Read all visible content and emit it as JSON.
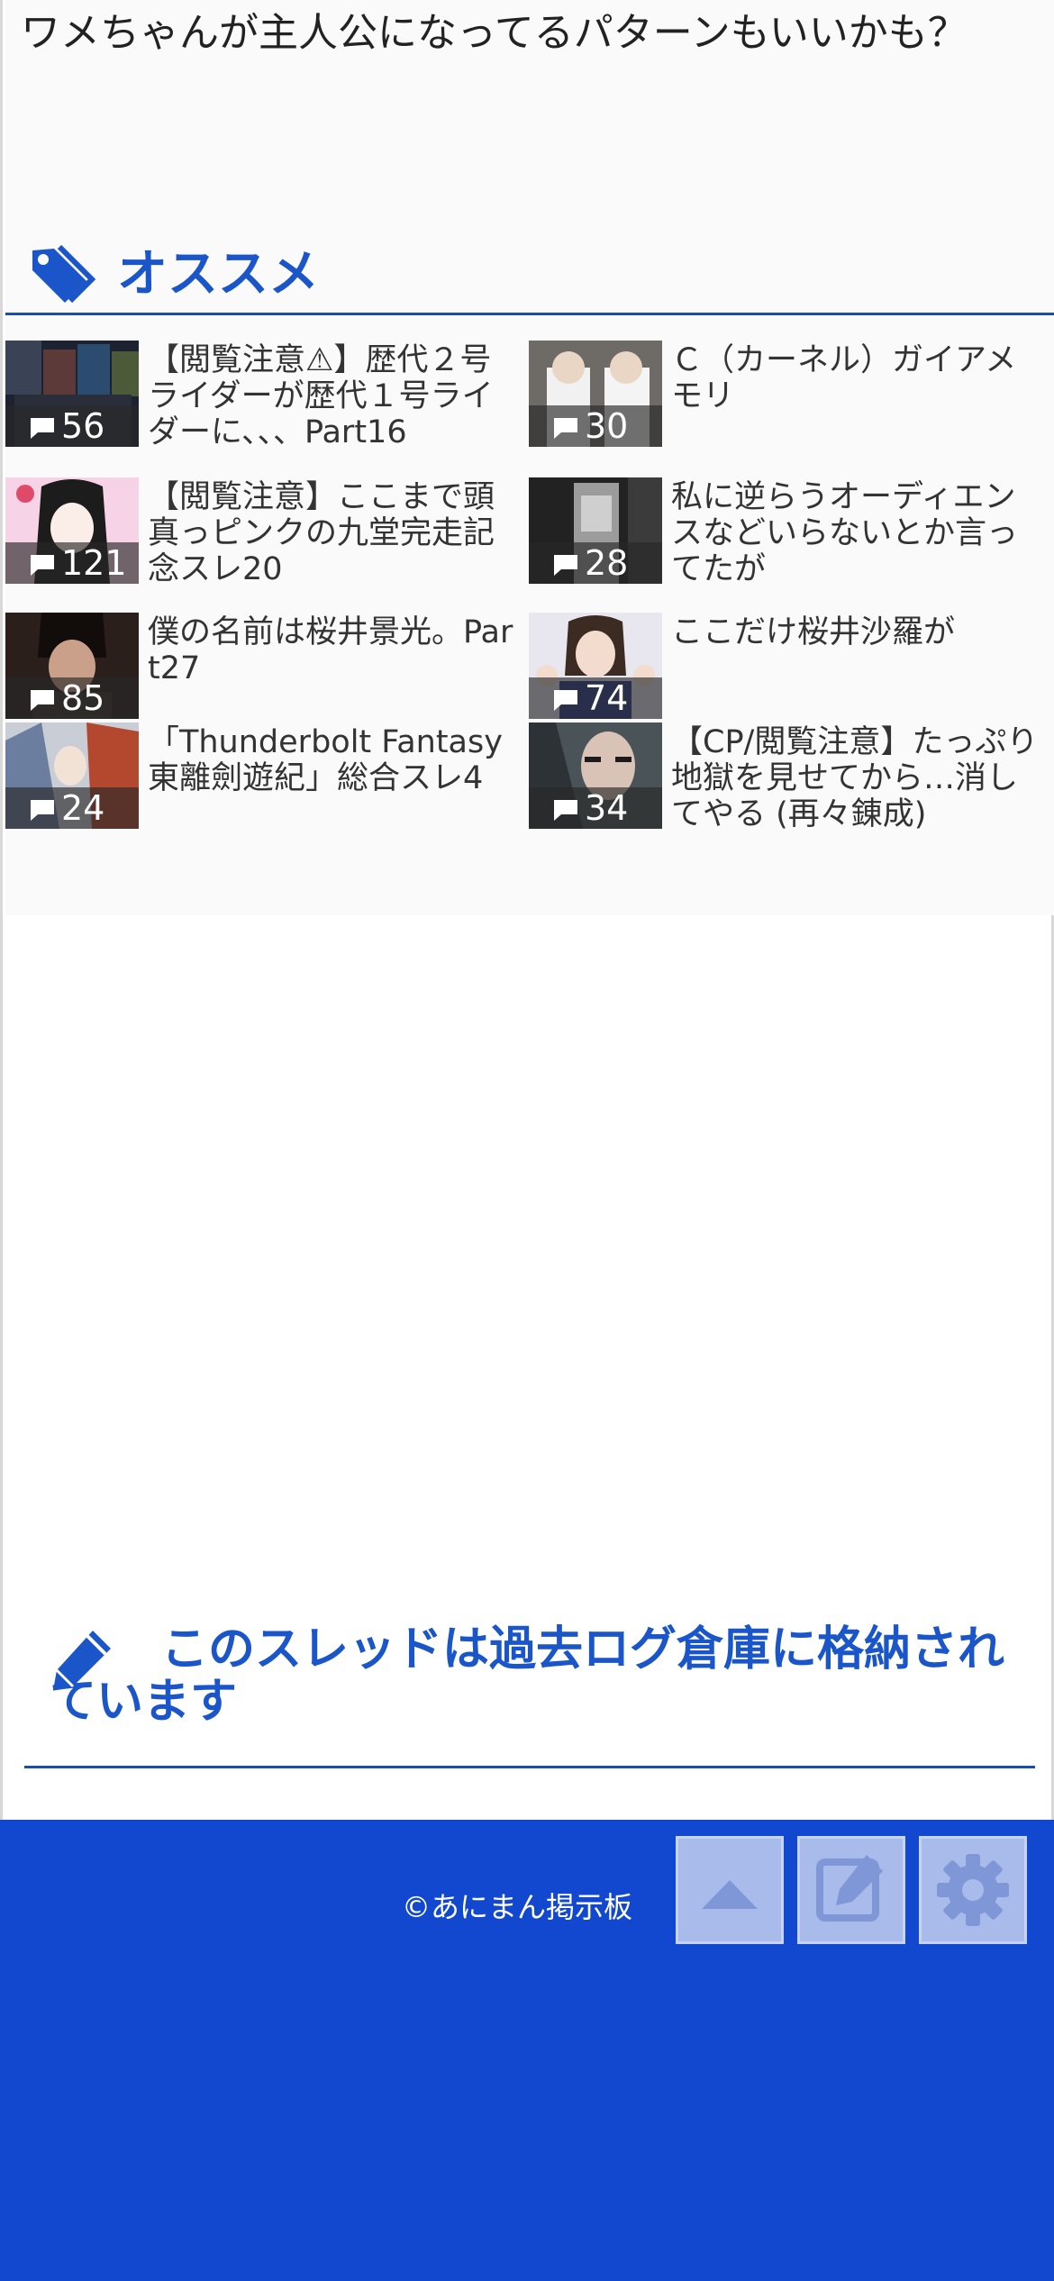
{
  "comment": {
    "text": "ワメちゃんが主人公になってるパターンもいいかも？"
  },
  "recommend": {
    "title": "オススメ",
    "icon": "tag-icon",
    "items": [
      {
        "count": "56",
        "title": "【閲覧注意⚠】歴代２号ライダーが歴代１号ライダーに、、、Part16"
      },
      {
        "count": "30",
        "title": "Ｃ（カーネル）ガイアメモリ"
      },
      {
        "count": "121",
        "title": "【閲覧注意】ここまで頭真っピンクの九堂完走記念スレ20"
      },
      {
        "count": "28",
        "title": "私に逆らうオーディエンスなどいらないとか言ってたが"
      },
      {
        "count": "85",
        "title": "僕の名前は桜井景光。Part27"
      },
      {
        "count": "74",
        "title": "ここだけ桜井沙羅が"
      },
      {
        "count": "24",
        "title": "「Thunderbolt Fantasy 東離劍遊紀」総合スレ4"
      },
      {
        "count": "34",
        "title": "【CP/閲覧注意】たっぷり地獄を見せてから…消してやる (再々錬成)"
      }
    ]
  },
  "archive": {
    "icon": "pencil-icon",
    "message": "このスレッドは過去ログ倉庫に格納されています"
  },
  "footer": {
    "copyright": "©あにまん掲示板",
    "buttons": [
      "scroll-top-icon",
      "edit-icon",
      "gear-icon"
    ]
  },
  "colors": {
    "accent": "#1a56c9",
    "footer_bg": "#1148cf",
    "button_bg": "#a8bbea"
  }
}
